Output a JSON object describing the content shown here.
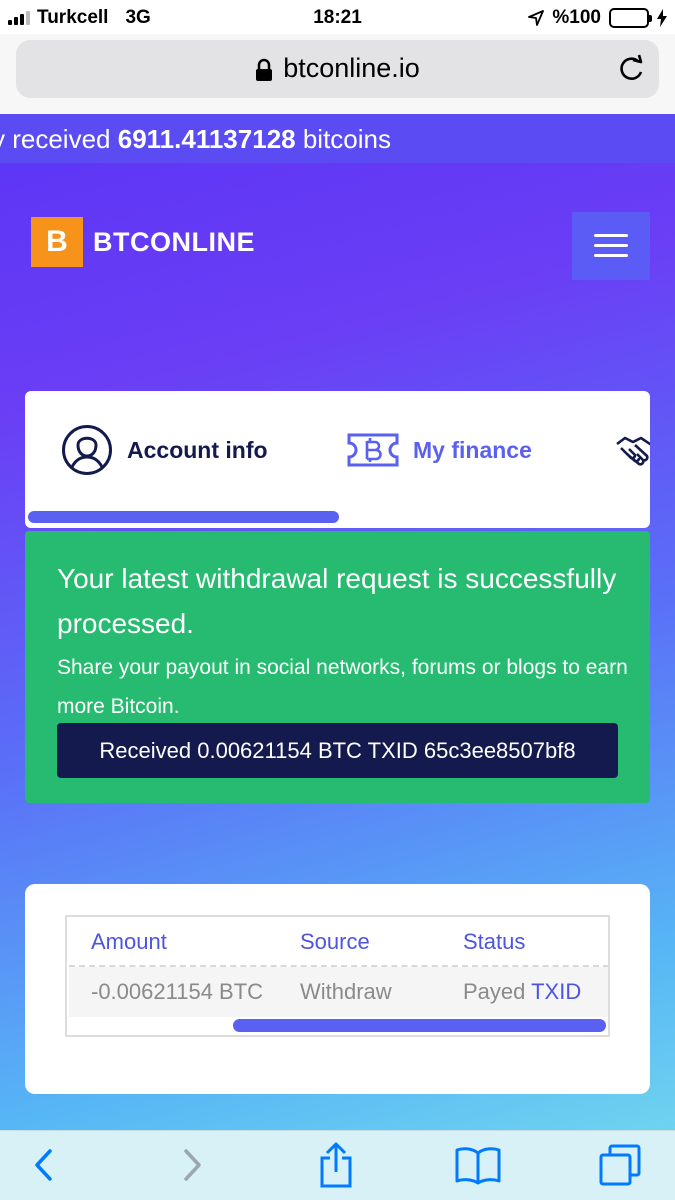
{
  "status_bar": {
    "carrier": "Turkcell",
    "network": "3G",
    "time": "18:21",
    "battery_text": "%100",
    "battery_level": 1.0,
    "icons": [
      "signal-icon",
      "location-arrow-icon",
      "battery-icon",
      "charging-bolt-icon"
    ]
  },
  "browser": {
    "url": "btconline.io",
    "icons": [
      "lock-icon",
      "reload-icon"
    ],
    "toolbar_icons": [
      "back-icon",
      "forward-icon",
      "share-icon",
      "bookmarks-icon",
      "tabs-icon"
    ]
  },
  "ticker": {
    "prefix": "y received ",
    "amount": "6911.41137128",
    "suffix": " bitcoins"
  },
  "header": {
    "logo_mark": "B",
    "logo_text": "BTCONLINE",
    "menu_icon": "hamburger-menu-icon"
  },
  "tabs": [
    {
      "label": "Account info",
      "icon": "user-circle-icon",
      "color": "#141a4d",
      "active": true
    },
    {
      "label": "My finance",
      "icon": "bitcoin-ticket-icon",
      "color": "#5a60f0",
      "active": false
    },
    {
      "label": "",
      "icon": "handshake-icon",
      "color": "#141a4d",
      "active": false
    }
  ],
  "notice": {
    "title": "Your latest withdrawal request is successfully processed.",
    "subtitle": "Share your payout in social networks, forums or blogs to earn more Bitcoin.",
    "txid_text": "Received 0.00621154 BTC TXID 65c3ee8507bf8"
  },
  "table": {
    "headers": [
      "Amount",
      "Source",
      "Status"
    ],
    "rows": [
      {
        "amount": "-0.00621154 BTC",
        "source": "Withdraw",
        "status": "Payed",
        "link": "TXID"
      }
    ]
  },
  "colors": {
    "accent": "#5a60f0",
    "navy": "#141a4d",
    "success": "#26bb70",
    "bitcoin_orange": "#f7931a",
    "ios_link_blue": "#007aff"
  }
}
